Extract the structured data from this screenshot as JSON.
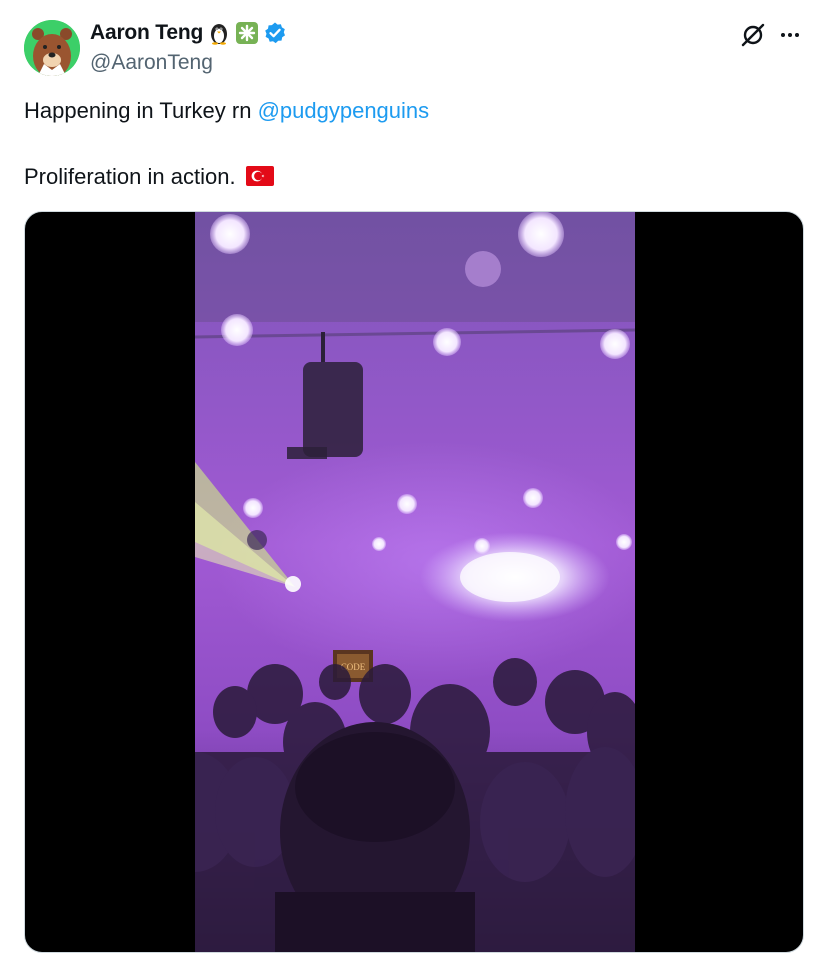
{
  "author": {
    "display_name": "Aaron Teng",
    "handle": "@AaronTeng",
    "badge_emojis": [
      "penguin",
      "sparkle"
    ],
    "verified": true
  },
  "tweet": {
    "line1_text": "Happening in Turkey rn ",
    "line1_mention": "@pudgypenguins",
    "line2_text": "Proliferation in action.",
    "line2_flag": "turkey-flag"
  },
  "media": {
    "type": "video",
    "sign_text": "CODE"
  },
  "colors": {
    "link": "#1d9bf0",
    "handle": "#536471",
    "verified": "#1d9bf0",
    "avatar_bg": "#3ccf68"
  },
  "icons": [
    "grok-icon",
    "more-icon",
    "verified-icon",
    "penguin-icon",
    "sparkle-icon",
    "turkey-flag-icon"
  ]
}
